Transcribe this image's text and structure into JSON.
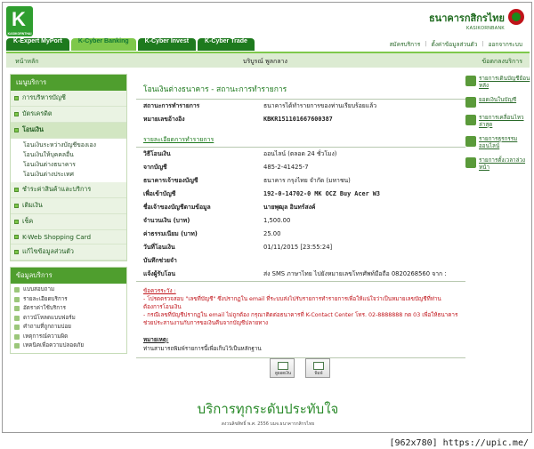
{
  "header": {
    "logo_text": "K",
    "logo_sub": "KASIKORNTHAI",
    "bank_name_th": "ธนาคารกสิกรไทย",
    "bank_name_en": "KASIKORNBANK",
    "tabs": [
      "K-Expert MyPort",
      "K-Cyber Banking",
      "K-Cyber Invest",
      "K-Cyber Trade"
    ],
    "links": [
      "สมัครบริการ",
      "ตั้งค่าข้อมูลส่วนตัว",
      "ออกจากระบบ"
    ]
  },
  "subbar": {
    "home": "หน้าหลัก",
    "greeting": "บริบูรณ์ พูลกลาง",
    "agreement": "ข้อตกลงบริการ"
  },
  "menu": {
    "title": "เมนูบริการ",
    "items": [
      {
        "label": "การบริหารบัญชี"
      },
      {
        "label": "บัตรเครดิต"
      },
      {
        "label": "โอนเงิน"
      },
      {
        "label": "ชำระค่าสินค้าและบริการ"
      },
      {
        "label": "เติมเงิน"
      },
      {
        "label": "เช็ค"
      },
      {
        "label": "K-Web Shopping Card"
      },
      {
        "label": "แก้ไขข้อมูลส่วนตัว"
      }
    ],
    "transfer_sub": [
      "โอนเงินระหว่างบัญชีของเอง",
      "โอนเงินให้บุคคลอื่น",
      "โอนเงินต่างธนาคาร",
      "โอนเงินต่างประเทศ"
    ]
  },
  "services": {
    "title": "ข้อมูลบริการ",
    "items": [
      "แบบสอบถาม",
      "รายละเอียดบริการ",
      "อัตราค่าใช้บริการ",
      "ดาวน์โหลดแบบฟอร์ม",
      "คำถามที่ถูกถามบ่อย",
      "เหตุการณ์ความผิด",
      "เทคนิคเพื่อความปลอดภัย"
    ]
  },
  "main": {
    "title": "โอนเงินต่างธนาคาร - สถานะการทำรายการ",
    "status_label": "สถานะการทำรายการ",
    "status_value": "ธนาคารได้ทำรายการของท่านเรียบร้อยแล้ว",
    "ref_label": "หมายเลขอ้างอิง",
    "ref_value": "KBKR151101667600387",
    "section_title": "รายละเอียดการทำรายการ",
    "rows": [
      {
        "k": "วิธีโอนเงิน",
        "v": "ออนไลน์ (ตลอด 24 ชั่วโมง)"
      },
      {
        "k": "จากบัญชี",
        "v": "485-2-41425-7"
      },
      {
        "k": "ธนาคารเจ้าของบัญชี",
        "v": "ธนาคาร กรุงไทย จำกัด (มหาชน)"
      },
      {
        "k": "เพื่อเข้าบัญชี",
        "v": "192-0-14702-0 MK OCZ Buy Acer W3"
      },
      {
        "k": "ชื่อเจ้าของบัญชีตามข้อมูล",
        "v": "นายพุฒุล อินทร์สงค์"
      },
      {
        "k": "จำนวนเงิน (บาท)",
        "v": "1,500.00"
      },
      {
        "k": "ค่าธรรมเนียม (บาท)",
        "v": "25.00"
      },
      {
        "k": "วันที่โอนเงิน",
        "v": "01/11/2015 [23:55:24]"
      },
      {
        "k": "บันทึกช่วยจำ",
        "v": ""
      },
      {
        "k": "แจ้งผู้รับโอน",
        "v": "ส่ง SMS ภาษาไทย ไปยังหมายเลขโทรศัพท์มือถือ 0820268560 จาก :"
      }
    ],
    "note_title": "ข้อควรระวัง :",
    "note_1": "- โปรดตรวจสอบ \"เลขที่บัญชี\" ซึ่งปรากฏใน email ที่ระบบส่งไปรับรายการทำรายการเพื่อให้แน่ใจว่าเป็นหมายเลขบัญชีที่ท่านต้องการโอนเงิน",
    "note_2": "- กรณีเลขที่บัญชีปรากฏใน email ไม่ถูกต้อง กรุณาติดต่อธนาคารที่ K-Contact Center โทร. 02-8888888 กด 03 เพื่อให้ธนาคารช่วยประสานงานกับการขอเงินคืนจากบัญชีปลายทาง",
    "remark_title": "หมายเหตุ:",
    "remark_text": "ท่านสามารถพิมพ์รายการนี้เพื่อเก็บไว้เป็นหลักฐาน",
    "btn_view": "ดูยอดเงิน",
    "btn_print": "พิมพ์"
  },
  "right": [
    {
      "label": "รายการเดินบัญชีย้อนหลัง"
    },
    {
      "label": "ยอดเงินในบัญชี"
    },
    {
      "label": "รายการเคลื่อนไหวล่าสุด"
    },
    {
      "label": "รายการธุรกรรมออนไลน์"
    },
    {
      "label": "รายการตั้งเวลาล่วงหน้า"
    }
  ],
  "footer": {
    "slogan": "บริการทุกระดับประทับใจ",
    "copyright": "สงวนลิขสิทธิ์ พ.ศ. 2556 บมจ.ธนาคารกสิกรไทย",
    "watermark": "[962x780] https://upic.me/"
  }
}
